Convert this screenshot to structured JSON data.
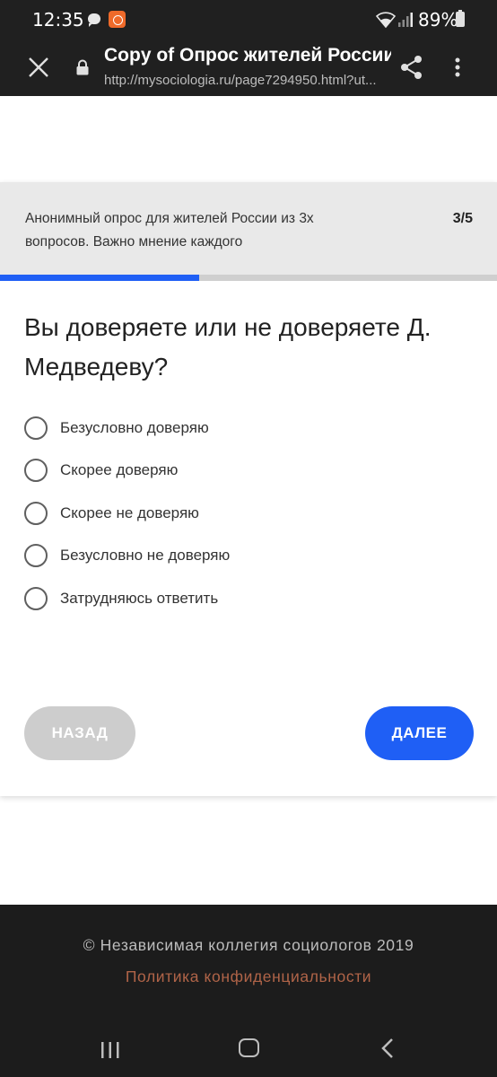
{
  "status_bar": {
    "time": "12:35",
    "battery": "89%"
  },
  "browser": {
    "title": "Copy of Опрос жителей России",
    "url": "http://mysociologia.ru/page7294950.html?ut..."
  },
  "survey": {
    "header_text": "Анонимный опрос для жителей России из 3х вопросов. Важно мнение каждого",
    "progress_label": "3/5",
    "progress_fraction": 0.4,
    "question": "Вы доверяете или не доверяете Д. Медведеву?",
    "options": [
      "Безусловно доверяю",
      "Скорее доверяю",
      "Скорее не доверяю",
      "Безусловно не доверяю",
      "Затрудняюсь ответить"
    ],
    "back_label": "НАЗАД",
    "next_label": "ДАЛЕЕ"
  },
  "footer": {
    "copyright": "© Независимая коллегия социологов 2019",
    "privacy_link": "Политика конфиденциальности"
  },
  "colors": {
    "accent": "#1f5ff5",
    "progress_track": "#cfcfcf",
    "link": "#b06448"
  }
}
